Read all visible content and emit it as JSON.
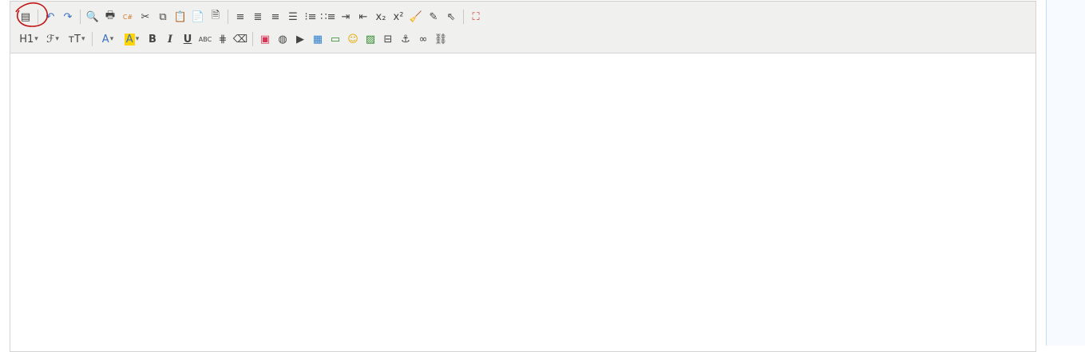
{
  "toolbar": {
    "row1": [
      {
        "name": "source-icon",
        "glyph": "▤"
      },
      {
        "sep": true
      },
      {
        "name": "undo-icon",
        "glyph": "↶",
        "color": "#3b6fc6"
      },
      {
        "name": "redo-icon",
        "glyph": "↷",
        "color": "#3b6fc6"
      },
      {
        "sep": true
      },
      {
        "name": "preview-icon",
        "glyph": "🔍"
      },
      {
        "name": "print-icon",
        "glyph": "🖶"
      },
      {
        "name": "code-icon",
        "glyph": "C#",
        "color": "#d37a2c",
        "small": true
      },
      {
        "name": "cut-icon",
        "glyph": "✂"
      },
      {
        "name": "copy-icon",
        "glyph": "⧉"
      },
      {
        "name": "paste-icon",
        "glyph": "📋"
      },
      {
        "name": "paste-text-icon",
        "glyph": "📄"
      },
      {
        "name": "paste-word-icon",
        "glyph": "🗎"
      },
      {
        "sep": true
      },
      {
        "name": "align-left-icon",
        "glyph": "≡"
      },
      {
        "name": "align-center-icon",
        "glyph": "≣"
      },
      {
        "name": "align-right-icon",
        "glyph": "≡"
      },
      {
        "name": "align-justify-icon",
        "glyph": "☰"
      },
      {
        "name": "ordered-list-icon",
        "glyph": "⁝≡"
      },
      {
        "name": "unordered-list-icon",
        "glyph": "∷≡"
      },
      {
        "name": "indent-icon",
        "glyph": "⇥"
      },
      {
        "name": "outdent-icon",
        "glyph": "⇤"
      },
      {
        "name": "subscript-icon",
        "glyph": "x₂"
      },
      {
        "name": "superscript-icon",
        "glyph": "x²"
      },
      {
        "name": "clear-format-icon",
        "glyph": "🧹"
      },
      {
        "name": "quick-format-icon",
        "glyph": "✎"
      },
      {
        "name": "select-all-icon",
        "glyph": "⇖"
      },
      {
        "sep": true
      },
      {
        "name": "fullscreen-icon",
        "glyph": "⛶",
        "color": "#c33"
      }
    ],
    "row2": [
      {
        "name": "heading-icon",
        "glyph": "H1",
        "drop": true
      },
      {
        "name": "font-family-icon",
        "glyph": "ℱ",
        "drop": true
      },
      {
        "name": "font-size-icon",
        "glyph": "ᴛT",
        "drop": true
      },
      {
        "sep": true
      },
      {
        "name": "font-color-icon",
        "glyph": "A",
        "drop": true,
        "color": "#3b6fc6"
      },
      {
        "name": "highlight-color-icon",
        "glyph": "A",
        "drop": true,
        "bg": "#ffd400",
        "color": "#3b6fc6"
      },
      {
        "name": "bold-icon",
        "glyph": "B",
        "bold": true
      },
      {
        "name": "italic-icon",
        "glyph": "I",
        "italic": true
      },
      {
        "name": "underline-icon",
        "glyph": "U",
        "underline": true
      },
      {
        "name": "strikethrough-icon",
        "glyph": "ABC",
        "small": true
      },
      {
        "name": "line-height-icon",
        "glyph": "⋕"
      },
      {
        "name": "eraser-icon",
        "glyph": "⌫"
      },
      {
        "sep": true
      },
      {
        "name": "image-icon",
        "glyph": "▣",
        "color": "#d35"
      },
      {
        "name": "flash-icon",
        "glyph": "◍"
      },
      {
        "name": "media-icon",
        "glyph": "▶"
      },
      {
        "name": "table-icon",
        "glyph": "▦",
        "color": "#2d7fd0"
      },
      {
        "name": "horizontal-rule-icon",
        "glyph": "▭",
        "color": "#2a8a2a"
      },
      {
        "name": "emoticon-icon",
        "glyph": "☺",
        "color": "#e5a800"
      },
      {
        "name": "insert-picture-icon",
        "glyph": "▨",
        "color": "#2a8a2a"
      },
      {
        "name": "page-break-icon",
        "glyph": "⊟"
      },
      {
        "name": "anchor-icon",
        "glyph": "⚓"
      },
      {
        "name": "link-icon",
        "glyph": "∞"
      },
      {
        "name": "unlink-icon",
        "glyph": "⛓"
      }
    ]
  }
}
